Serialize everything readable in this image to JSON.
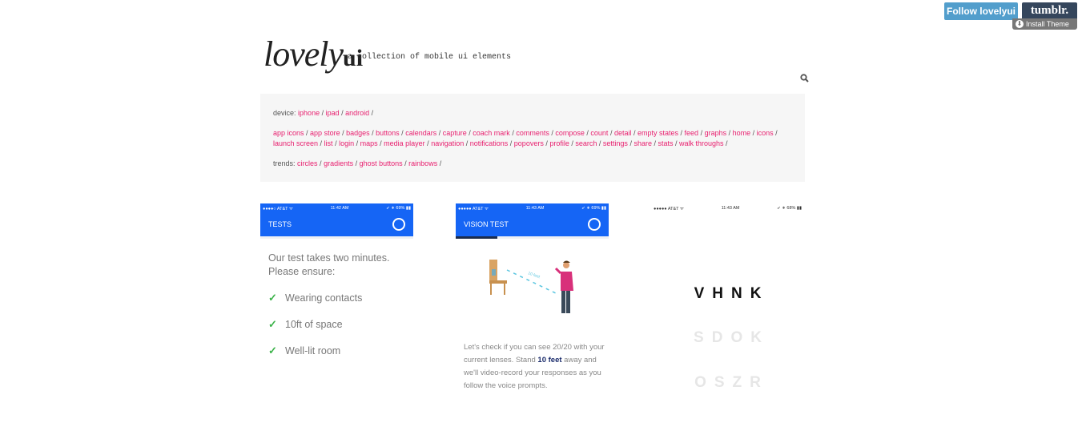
{
  "tumblr_bar": {
    "follow_label": "Follow lovelyui",
    "tumblr_logo": "tumblr.",
    "install_label": "Install Theme"
  },
  "header": {
    "logo_script": "lovely",
    "logo_bold": "ui",
    "tagline": "a collection of mobile ui elements",
    "search_icon": "search-icon"
  },
  "filters": {
    "device_label": "device:",
    "device": [
      "iphone",
      "ipad",
      "android"
    ],
    "categories": [
      "app icons",
      "app store",
      "badges",
      "buttons",
      "calendars",
      "capture",
      "coach mark",
      "comments",
      "compose",
      "count",
      "detail",
      "empty states",
      "feed",
      "graphs",
      "home",
      "icons",
      "launch screen",
      "list",
      "login",
      "maps",
      "media player",
      "navigation",
      "notifications",
      "popovers",
      "profile",
      "search",
      "settings",
      "share",
      "stats",
      "walk throughs"
    ],
    "trends_label": "trends:",
    "trends": [
      "circles",
      "gradients",
      "ghost buttons",
      "rainbows"
    ],
    "link_color": "#e8206f"
  },
  "cards": [
    {
      "status": {
        "carrier": "●●●●○ AT&T ᯤ",
        "time": "11:42 AM",
        "battery": "➶ ∗ 69% ▮▮"
      },
      "title": "TESTS",
      "intro": "Our test takes two minutes. Please ensure:",
      "checks": [
        "Wearing contacts",
        "10ft of space",
        "Well-lit room"
      ]
    },
    {
      "status": {
        "carrier": "●●●●● AT&T ᯤ",
        "time": "11:43 AM",
        "battery": "➶ ∗ 69% ▮▮"
      },
      "title": "VISION TEST",
      "illustration_label": "10 feet",
      "text_before": "Let's check if you can see 20/20 with your current lenses. Stand ",
      "text_bold": "10 feet",
      "text_after": " away and we'll video-record your responses as you follow the voice prompts."
    },
    {
      "status": {
        "carrier": "●●●●● AT&T ᯤ",
        "time": "11:43 AM",
        "battery": "➶ ∗ 68% ▮▮"
      },
      "rows": [
        "VHNK",
        "SDOK",
        "OSZR"
      ]
    }
  ],
  "accent": "#1565f5"
}
